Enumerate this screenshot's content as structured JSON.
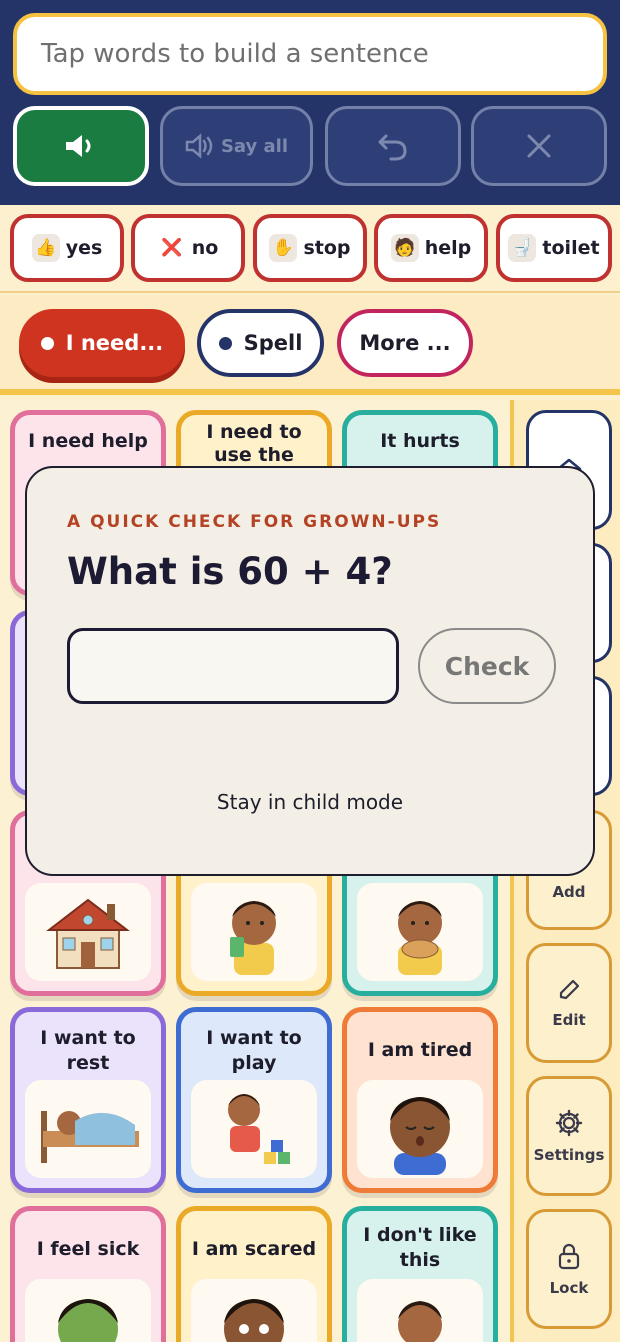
{
  "sentence": {
    "placeholder": "Tap words to build a sentence"
  },
  "controls": {
    "say_all": "Say all"
  },
  "quick_words": [
    {
      "label": "yes",
      "icon": "👍"
    },
    {
      "label": "no",
      "icon": "❌"
    },
    {
      "label": "stop",
      "icon": "✋"
    },
    {
      "label": "help",
      "icon": "🧑"
    },
    {
      "label": "toilet",
      "icon": "🚽"
    }
  ],
  "categories": [
    {
      "label": "I need..."
    },
    {
      "label": "Spell"
    },
    {
      "label": "More ..."
    }
  ],
  "tiles": [
    {
      "label": "I need help"
    },
    {
      "label": "I need to use the toilet"
    },
    {
      "label": "It hurts"
    },
    {
      "label": "I want to rest"
    },
    {
      "label": "I want to play"
    },
    {
      "label": "I am tired"
    },
    {
      "label": "I feel sick"
    },
    {
      "label": "I am scared"
    },
    {
      "label": "I don't like this"
    }
  ],
  "sidebar": {
    "add": "Add",
    "edit": "Edit",
    "settings": "Settings",
    "lock": "Lock"
  },
  "modal": {
    "eyebrow": "A QUICK CHECK FOR GROWN-UPS",
    "question": "What is 60 + 4?",
    "check_label": "Check",
    "stay_label": "Stay in child mode"
  },
  "colors": {
    "header": "#243468",
    "speak": "#1b7c41",
    "need_pill": "#cf3421",
    "quick_border": "#c0322f"
  }
}
